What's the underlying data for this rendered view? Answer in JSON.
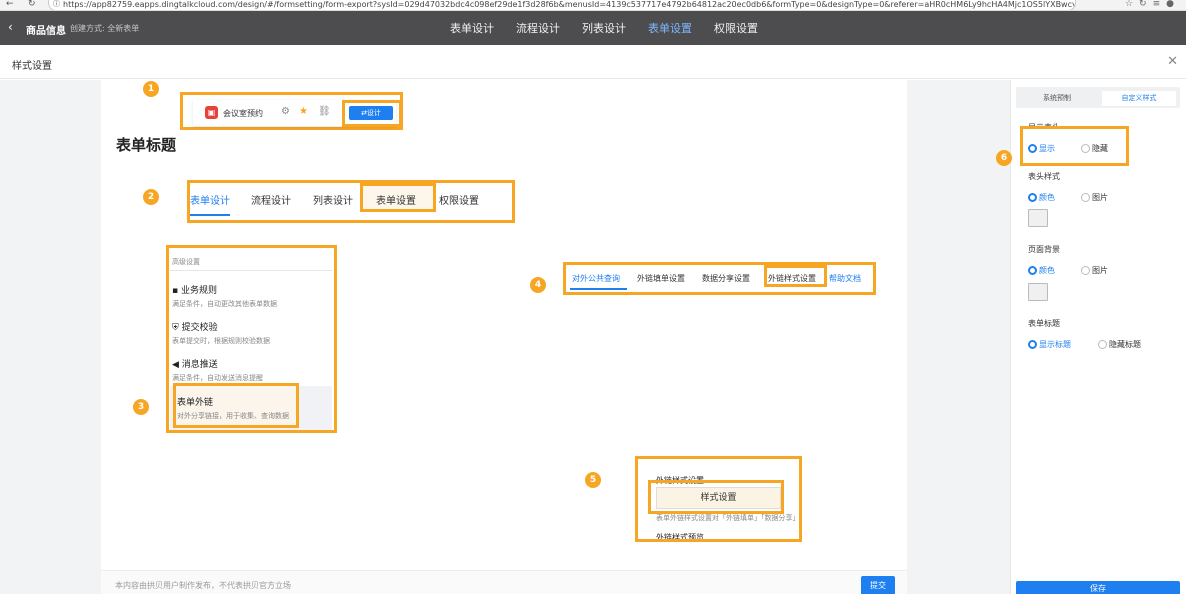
{
  "browser": {
    "url": "https://app82759.eapps.dingtalkcloud.com/design/#/formsetting/form-export?sysId=029d47032bdc4c098ef29de1f3d28f6b&menusId=4139c537717e4792b64812ac20ec0db6&formType=0&designType=0&referer=aHR0cHM6Ly9hcHA4Mjc1OS5lYXBwcy5kaW5n..."
  },
  "appbar": {
    "app_name": "商品信息",
    "create_mode": "创建方式: 全新表单",
    "tabs": [
      "表单设计",
      "流程设计",
      "列表设计",
      "表单设置",
      "权限设置"
    ]
  },
  "dialog": {
    "title": "样式设置"
  },
  "preview": {
    "form_title": "表单标题",
    "toolbar": {
      "app_name": "会议室预约",
      "design_label": "⇄设计"
    },
    "form_tabs": [
      "表单设计",
      "流程设计",
      "列表设计",
      "表单设置",
      "权限设置"
    ],
    "advanced": {
      "title": "高级设置",
      "items": [
        {
          "name": "业务规则",
          "desc": "满足条件，自动更改其他表单数据"
        },
        {
          "name": "提交校验",
          "desc": "表单提交时，根据规则校验数据"
        },
        {
          "name": "消息推送",
          "desc": "满足条件，自动发送消息提醒"
        },
        {
          "name": "表单外链",
          "desc": "对外分享链接，用于收集、查询数据"
        }
      ]
    },
    "link_tabs": [
      "对外公共查询",
      "外链填单设置",
      "数据分享设置",
      "外链样式设置",
      "帮助文档"
    ],
    "link_style": {
      "label": "外链样式设置",
      "button": "样式设置",
      "desc": "表单外链样式设置对「外链填单」「数据分享」生效",
      "preview_label": "外链样式预览"
    },
    "footer": {
      "note": "本内容由拱贝用户制作发布，不代表拱贝官方立场",
      "submit": "提交"
    },
    "markers": [
      "1",
      "2",
      "3",
      "4",
      "5",
      "6"
    ]
  },
  "panel": {
    "seg": [
      "系统预制",
      "自定义样式"
    ],
    "show_header": {
      "label": "显示表头",
      "options": [
        "显示",
        "隐藏"
      ]
    },
    "header_style": {
      "label": "表头样式",
      "options": [
        "颜色",
        "图片"
      ]
    },
    "page_bg": {
      "label": "页面背景",
      "options": [
        "颜色",
        "图片"
      ]
    },
    "form_title": {
      "label": "表单标题",
      "options": [
        "显示标题",
        "隐藏标题"
      ]
    },
    "save": "保存"
  },
  "colors": {
    "accent": "#1e7ff0",
    "highlight": "#f6a623",
    "topbar": "#4d4d4f"
  }
}
